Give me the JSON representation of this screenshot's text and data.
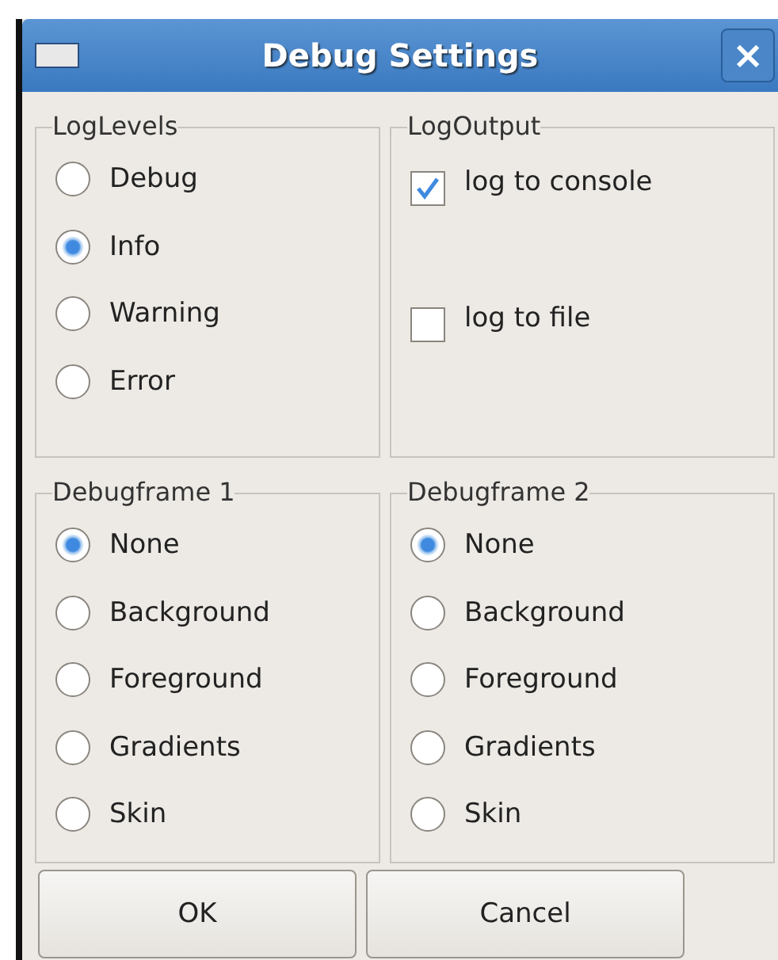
{
  "window": {
    "title": "Debug Settings",
    "close": "×"
  },
  "groups": [
    {
      "title": "LogLevels",
      "kind": "radio",
      "items": [
        {
          "label": "Debug",
          "selected": false
        },
        {
          "label": "Info",
          "selected": true
        },
        {
          "label": "Warning",
          "selected": false
        },
        {
          "label": "Error",
          "selected": false
        }
      ]
    },
    {
      "title": "LogOutput",
      "kind": "check",
      "items": [
        {
          "label": "log to console",
          "checked": true
        },
        {
          "label": "log to file",
          "checked": false
        }
      ]
    },
    {
      "title": "Debugframe 1",
      "kind": "radio",
      "items": [
        {
          "label": "None",
          "selected": true
        },
        {
          "label": "Background",
          "selected": false
        },
        {
          "label": "Foreground",
          "selected": false
        },
        {
          "label": "Gradients",
          "selected": false
        },
        {
          "label": "Skin",
          "selected": false
        }
      ]
    },
    {
      "title": "Debugframe 2",
      "kind": "radio",
      "items": [
        {
          "label": "None",
          "selected": true
        },
        {
          "label": "Background",
          "selected": false
        },
        {
          "label": "Foreground",
          "selected": false
        },
        {
          "label": "Gradients",
          "selected": false
        },
        {
          "label": "Skin",
          "selected": false
        }
      ]
    }
  ],
  "buttons": [
    "OK",
    "Cancel"
  ]
}
